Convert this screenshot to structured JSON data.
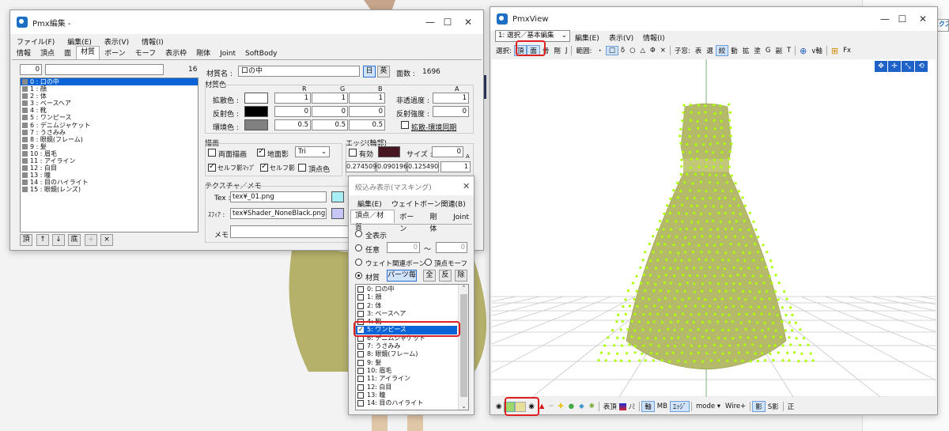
{
  "colors": {
    "accent": "#0a64d8",
    "highlight": "#e02020",
    "mesh": "#b5b96a",
    "vertex": "#aaff00",
    "editorBg": "#ffffff"
  },
  "edit_window": {
    "title": "Pmx編集 - ",
    "menu": [
      "ファイル(F)",
      "編集(E)",
      "表示(V)",
      "情報(I)"
    ],
    "tabs": [
      "情報",
      "頂点",
      "面",
      "材質",
      "ボーン",
      "モーフ",
      "表示枠",
      "剛体",
      "Joint",
      "SoftBody"
    ],
    "active_tab": "材質",
    "index_value": "0",
    "material_count": "16",
    "materials": [
      "0 : 口の中",
      "1 : 顔",
      "2 : 体",
      "3 : ベースヘア",
      "4 : 靴",
      "5 : ワンピース",
      "6 : デニムジャケット",
      "7 : うさみみ",
      "8 : 眼鏡(フレーム)",
      "9 : 髪",
      "10 : 眉毛",
      "11 : アイライン",
      "12 : 白目",
      "13 : 瞳",
      "14 : 目のハイライト",
      "15 : 眼鏡(レンズ)"
    ],
    "list_buttons": [
      "頂",
      "↑",
      "↓",
      "底",
      "+",
      "×"
    ],
    "name_label": "材質名 :",
    "name_value": "口の中",
    "lang_jp": "日",
    "lang_en": "英",
    "face_count_label": "面数 :",
    "face_count": "1696",
    "color_section": "材質色",
    "rgba_headers": [
      "R",
      "G",
      "B",
      "A"
    ],
    "diffuse_label": "拡散色 :",
    "diffuse": [
      "1",
      "1",
      "1"
    ],
    "alpha_label": "非透過度 :",
    "alpha": "1",
    "specular_label": "反射色 :",
    "specular": [
      "0",
      "0",
      "0"
    ],
    "spec_power_label": "反射強度 :",
    "spec_power": "0",
    "ambient_label": "環境色 :",
    "ambient": [
      "0.5",
      "0.5",
      "0.5"
    ],
    "sync_label": "拡散-環境同期",
    "draw_section": "描画",
    "double_sided": "両面描画",
    "ground_shadow": "地面影",
    "shadow_mode": "Tri",
    "self_shadow_map": "セルフ影ﾏｯﾌﾟ",
    "self_shadow": "セルフ影",
    "vertex_color": "頂点色",
    "edge_section": "エッジ(輪郭)",
    "edge_enable": "有効",
    "edge_size_label": "サイズ :",
    "edge_size": "0",
    "edge_rgba": [
      "0.274509",
      "0.090196",
      "0.125490",
      "1"
    ],
    "texture_section": "テクスチャ／メモ",
    "tex_label": "Tex :",
    "tex_value": "tex¥_01.png",
    "sphere_label": "ｽﾌｨｱ :",
    "sphere_value": "tex¥Shader_NoneBlack.png",
    "memo_label": "メモ :"
  },
  "mask_window": {
    "title": "絞込み表示(マスキング)",
    "menu": [
      "編集(E)",
      "ウェイトボーン関連(B)"
    ],
    "tabs": [
      "頂点／材質",
      "ボーン",
      "剛体",
      "Joint"
    ],
    "show_all": "全表示",
    "arbitrary": "任意",
    "arb_from": "0",
    "tilde": "〜",
    "arb_to": "0",
    "weight_bone": "ウェイト関連ボーン",
    "vertex_morph": "頂点モーフ",
    "material": "材質",
    "per_part": "パーツ毎",
    "all_btn": "全",
    "invert_btn": "反",
    "remove_btn": "除",
    "items": [
      "0: 口の中",
      "1: 顔",
      "2: 体",
      "3: ベースヘア",
      "4: 靴",
      "5: ワンピース",
      "6: デニムジャケット",
      "7: うさみみ",
      "8: 眼鏡(フレーム)",
      "9: 髪",
      "10: 眉毛",
      "11: アイライン",
      "12: 白目",
      "13: 瞳",
      "14: 目のハイライト"
    ],
    "checked_index": 5
  },
  "view_window": {
    "title": "PmxView",
    "mode_select": "1: 選択／基本編集",
    "menu": [
      "編集(E)",
      "表示(V)",
      "情報(I)"
    ],
    "toolbar1": [
      "選択:",
      "頂",
      "面",
      "骨",
      "剛",
      "J",
      "範囲:",
      "・",
      "□",
      "δ",
      "○",
      "△",
      "Φ",
      "×",
      "子窓:",
      "表",
      "選",
      "絞",
      "動",
      "拡",
      "塗",
      "G",
      "副",
      "T",
      "v軸",
      "Fx"
    ],
    "toolbar_bottom": [
      "表頂",
      "ﾉﾐ",
      "軸",
      "MB",
      "ｴｯｼﾞ",
      "mode ▾",
      "Wire+",
      "影",
      "S影",
      "正"
    ]
  },
  "right_edge": {
    "text1": "エクス"
  }
}
